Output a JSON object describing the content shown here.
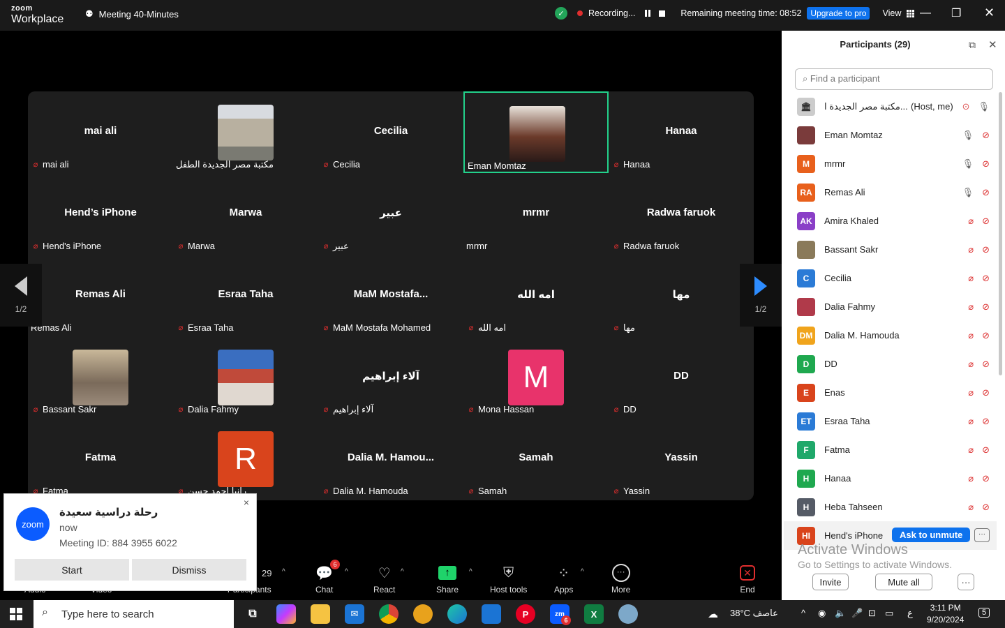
{
  "titlebar": {
    "brand_top": "zoom",
    "brand_bottom": "Workplace",
    "meeting_title": "Meeting 40-Minutes",
    "recording_label": "Recording...",
    "remaining_label": "Remaining meeting time: 08:52",
    "upgrade_label": "Upgrade to pro",
    "view_label": "View"
  },
  "gallery": {
    "page_indicator": "1/2",
    "tiles": [
      {
        "big": "mai ali",
        "label": "mai ali",
        "muted": true
      },
      {
        "big": "",
        "label": "مكتبة مصر الجديدة الطفل",
        "muted": false,
        "pic": "building-photo"
      },
      {
        "big": "Cecilia",
        "label": "Cecilia",
        "muted": true
      },
      {
        "big": "",
        "label": "Eman Momtaz",
        "muted": false,
        "pic": "woman-photo",
        "active": true
      },
      {
        "big": "Hanaa",
        "label": "Hanaa",
        "muted": true
      },
      {
        "big": "Hend’s iPhone",
        "label": "Hend's iPhone",
        "muted": true
      },
      {
        "big": "Marwa",
        "label": "Marwa",
        "muted": true
      },
      {
        "big": "عبير",
        "label": "عبير",
        "muted": true
      },
      {
        "big": "mrmr",
        "label": "mrmr",
        "muted": false
      },
      {
        "big": "Radwa faruok",
        "label": "Radwa faruok",
        "muted": true
      },
      {
        "big": "Remas Ali",
        "label": "Remas Ali",
        "muted": false
      },
      {
        "big": "Esraa Taha",
        "label": "Esraa Taha",
        "muted": true
      },
      {
        "big": "MaM  Mostafa...",
        "label": "MaM Mostafa Mohamed",
        "muted": true
      },
      {
        "big": "امه الله",
        "label": "امه الله",
        "muted": true
      },
      {
        "big": "مها",
        "label": "مها",
        "muted": true
      },
      {
        "big": "",
        "label": "Bassant Sakr",
        "muted": true,
        "pic": "child-photo"
      },
      {
        "big": "",
        "label": "Dalia Fahmy",
        "muted": true,
        "pic": "horse-photo"
      },
      {
        "big": "آلاء إبراهيم",
        "label": "آلاء إبراهيم",
        "muted": true
      },
      {
        "big": "",
        "label": "Mona Hassan",
        "muted": true,
        "letter": "M",
        "color": "#e8336b"
      },
      {
        "big": "DD",
        "label": "DD",
        "muted": true
      },
      {
        "big": "Fatma",
        "label": "Fatma",
        "muted": true
      },
      {
        "big": "",
        "label": "رانيا احمد حسن",
        "muted": true,
        "letter": "R",
        "color": "#d9441c"
      },
      {
        "big": "Dalia  M.  Hamou...",
        "label": "Dalia M. Hamouda",
        "muted": true
      },
      {
        "big": "Samah",
        "label": "Samah",
        "muted": true
      },
      {
        "big": "Yassin",
        "label": "Yassin",
        "muted": true
      }
    ]
  },
  "toolbar": {
    "participants_count": "29",
    "participants_label": "Participants",
    "audio_label": "Audio",
    "video_label": "Video",
    "chat_label": "Chat",
    "chat_badge": "6",
    "react_label": "React",
    "share_label": "Share",
    "host_tools_label": "Host tools",
    "apps_label": "Apps",
    "more_label": "More",
    "end_label": "End"
  },
  "notification": {
    "logo_text": "zoom",
    "title": "رحلة دراسية سعيدة",
    "time": "now",
    "meeting_id": "Meeting ID: 884 3955 6022",
    "start_label": "Start",
    "dismiss_label": "Dismiss",
    "close": "×"
  },
  "panel": {
    "title": "Participants (29)",
    "search_placeholder": "Find a participant",
    "host_row": {
      "name": "مكتبة مصر الجديدة ا...",
      "note": "(Host, me)"
    },
    "rows": [
      {
        "initials": "",
        "name": "Eman Momtaz",
        "color": "#7a3b3b",
        "mic": "on",
        "cam": "off"
      },
      {
        "initials": "M",
        "name": "mrmr",
        "color": "#e8601c",
        "mic": "on",
        "cam": "off"
      },
      {
        "initials": "RA",
        "name": "Remas Ali",
        "color": "#e8601c",
        "mic": "on",
        "cam": "off"
      },
      {
        "initials": "AK",
        "name": "Amira Khaled",
        "color": "#8a3fc7",
        "mic": "off",
        "cam": "off"
      },
      {
        "initials": "",
        "name": "Bassant Sakr",
        "color": "#8a7a5a",
        "mic": "off",
        "cam": "off"
      },
      {
        "initials": "C",
        "name": "Cecilia",
        "color": "#2b7bd6",
        "mic": "off",
        "cam": "off"
      },
      {
        "initials": "",
        "name": "Dalia Fahmy",
        "color": "#b03a4a",
        "mic": "off",
        "cam": "off"
      },
      {
        "initials": "DM",
        "name": "Dalia M. Hamouda",
        "color": "#f0a41c",
        "mic": "off",
        "cam": "off"
      },
      {
        "initials": "D",
        "name": "DD",
        "color": "#1fa84f",
        "mic": "off",
        "cam": "off"
      },
      {
        "initials": "E",
        "name": "Enas",
        "color": "#d9441c",
        "mic": "off",
        "cam": "off"
      },
      {
        "initials": "ET",
        "name": "Esraa Taha",
        "color": "#2b7bd6",
        "mic": "off",
        "cam": "off"
      },
      {
        "initials": "F",
        "name": "Fatma",
        "color": "#1fa86a",
        "mic": "off",
        "cam": "off"
      },
      {
        "initials": "H",
        "name": "Hanaa",
        "color": "#1fa84f",
        "mic": "off",
        "cam": "off"
      },
      {
        "initials": "H",
        "name": "Heba Tahseen",
        "color": "#555b66",
        "mic": "off",
        "cam": "off"
      }
    ],
    "hover_row": {
      "initials": "HI",
      "name": "Hend's iPhone",
      "color": "#d9441c",
      "ask_label": "Ask to unmute",
      "more": "···"
    },
    "watermark_title": "Activate Windows",
    "watermark_sub": "Go to Settings to activate Windows.",
    "invite_label": "Invite",
    "mute_all_label": "Mute all",
    "more_label": "···"
  },
  "taskbar": {
    "search_placeholder": "Type here to search",
    "weather": "38°C  عاصف",
    "lang": "ع",
    "time": "3:11 PM",
    "date": "9/20/2024",
    "notif_count": "5",
    "zoom_badge": "6"
  },
  "colors": {
    "accent": "#0e72ed",
    "active_border": "#23d18b",
    "muted_red": "#e02e2e"
  }
}
